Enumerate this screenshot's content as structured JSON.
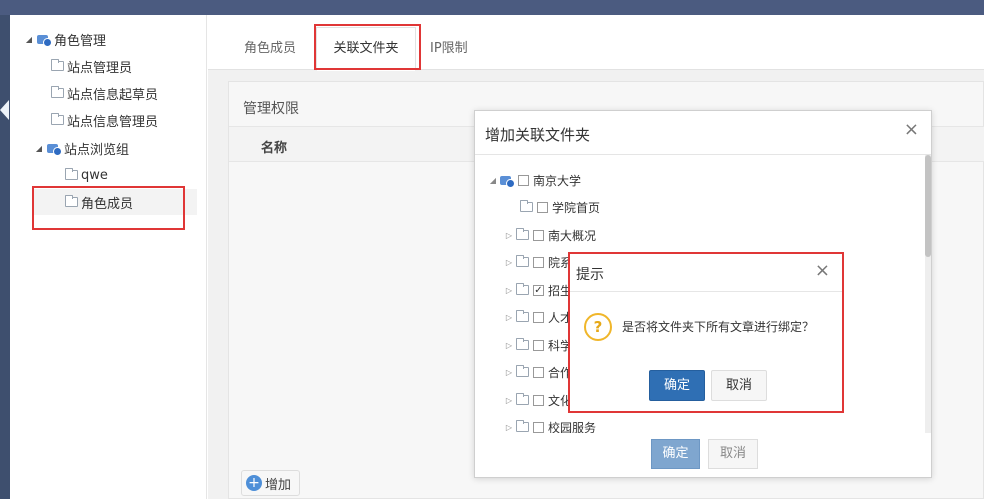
{
  "tree": {
    "items": [
      {
        "label": "角色管理",
        "icon": "users-icon",
        "expanded": true
      },
      {
        "label": "站点管理员",
        "icon": "folder-icon"
      },
      {
        "label": "站点信息起草员",
        "icon": "folder-icon"
      },
      {
        "label": "站点信息管理员",
        "icon": "folder-icon"
      },
      {
        "label": "站点浏览组",
        "icon": "users-icon",
        "expanded": true
      },
      {
        "label": "qwe",
        "icon": "folder-icon"
      },
      {
        "label": "角色成员",
        "icon": "folder-icon",
        "selected": true
      }
    ]
  },
  "tabs": [
    {
      "label": "角色成员"
    },
    {
      "label": "关联文件夹",
      "active": true
    },
    {
      "label": "IP限制"
    }
  ],
  "panel": {
    "title": "管理权限",
    "column_name": "名称",
    "add_label": "增加"
  },
  "dialog": {
    "title": "增加关联文件夹",
    "close": "×",
    "tree": [
      {
        "label": "南京大学",
        "level": 0,
        "expanded": true,
        "checked": false
      },
      {
        "label": "学院首页",
        "level": 1,
        "checked": false
      },
      {
        "label": "南大概况",
        "level": 1,
        "checked": false
      },
      {
        "label": "院系",
        "level": 1,
        "checked": false
      },
      {
        "label": "招生",
        "level": 1,
        "checked": true
      },
      {
        "label": "人才",
        "level": 1,
        "checked": false
      },
      {
        "label": "科学",
        "level": 1,
        "checked": false
      },
      {
        "label": "合作",
        "level": 1,
        "checked": false
      },
      {
        "label": "文化",
        "level": 1,
        "checked": false
      },
      {
        "label": "校园服务",
        "level": 1,
        "checked": false
      }
    ],
    "ok_label": "确定",
    "cancel_label": "取消"
  },
  "confirm": {
    "title": "提示",
    "close": "×",
    "icon": "question-icon",
    "message": "是否将文件夹下所有文章进行绑定？",
    "ok_label": "确定",
    "cancel_label": "取消"
  },
  "colors": {
    "topbar": "#4b5b80",
    "primary": "#2f6fb4",
    "highlight": "#e03636",
    "warning": "#f0b62a"
  }
}
